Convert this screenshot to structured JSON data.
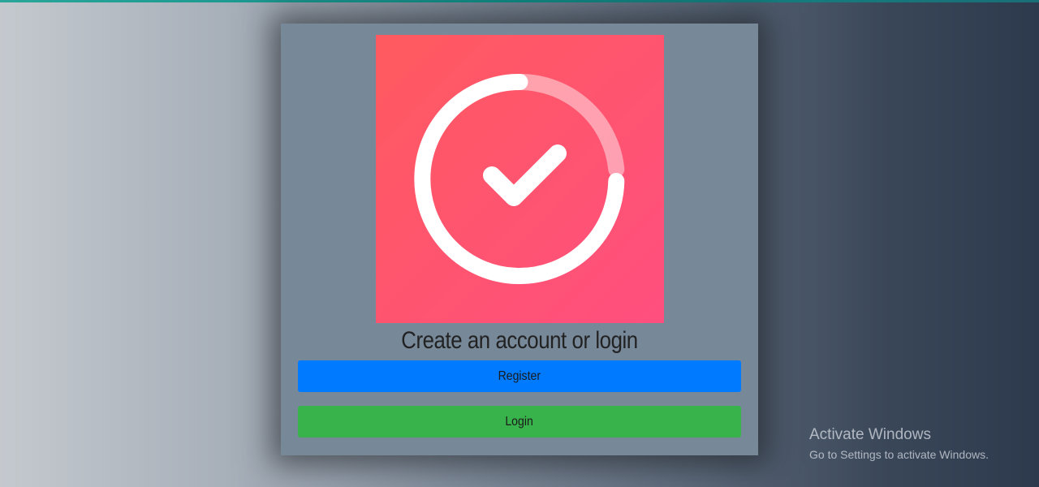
{
  "app": {
    "logo_icon": "checkmark-in-circle-icon",
    "logo_gradient": [
      "#ff5a5f",
      "#ff4f7f"
    ]
  },
  "card": {
    "heading": "Create an account or login"
  },
  "buttons": {
    "register": {
      "label": "Register",
      "color": "#007bff"
    },
    "login": {
      "label": "Login",
      "color": "#38b24a"
    }
  },
  "watermark": {
    "title": "Activate Windows",
    "subtitle": "Go to Settings to activate Windows."
  }
}
